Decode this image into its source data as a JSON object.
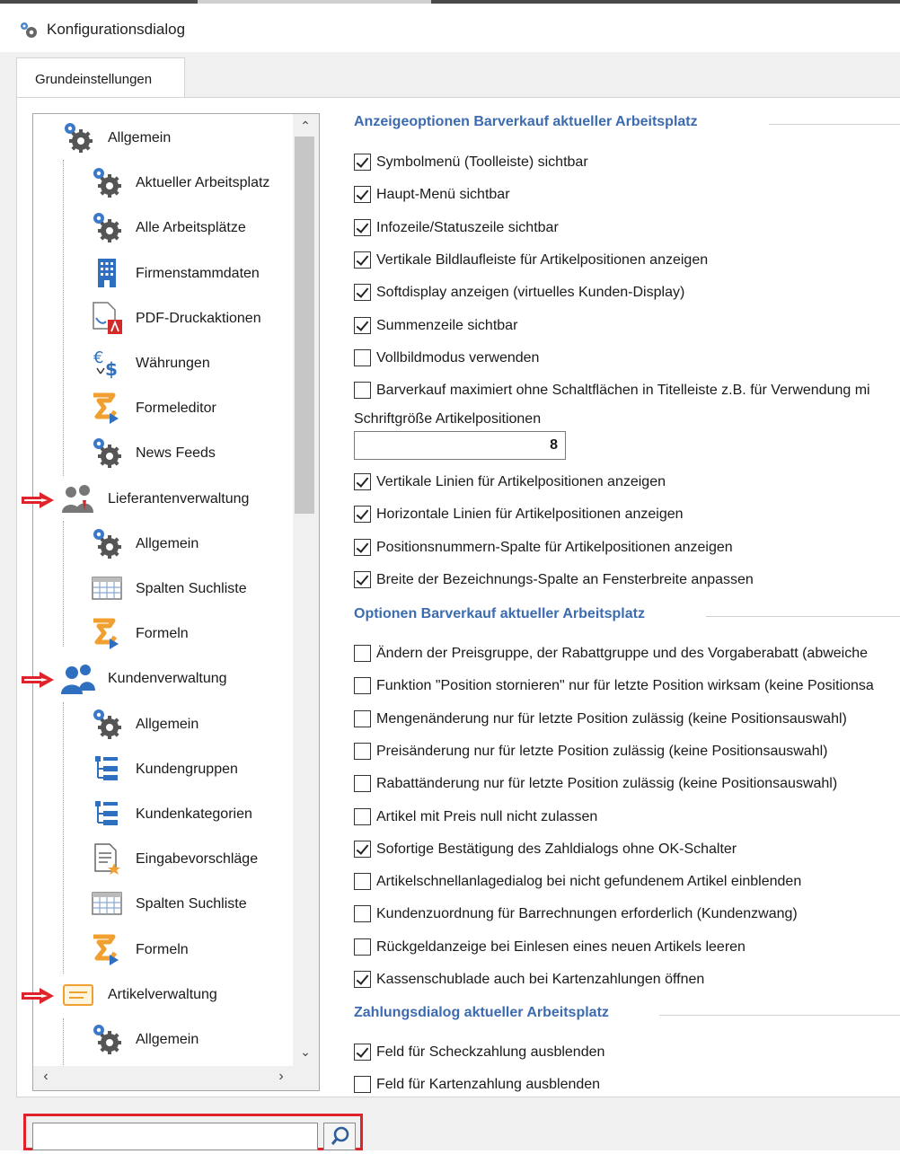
{
  "window": {
    "title": "Konfigurationsdialog"
  },
  "tabs": [
    {
      "label": "Grundeinstellungen"
    }
  ],
  "tree": {
    "items": [
      {
        "label": "Allgemein",
        "icon": "gears-icon"
      },
      {
        "label": "Aktueller Arbeitsplatz",
        "icon": "gears-icon"
      },
      {
        "label": "Alle Arbeitsplätze",
        "icon": "gears-icon"
      },
      {
        "label": "Firmenstammdaten",
        "icon": "building-icon"
      },
      {
        "label": "PDF-Druckaktionen",
        "icon": "pdf-document-icon"
      },
      {
        "label": "Währungen",
        "icon": "currency-icon"
      },
      {
        "label": "Formeleditor",
        "icon": "formula-icon"
      },
      {
        "label": "News Feeds",
        "icon": "gears-icon"
      },
      {
        "label": "Lieferantenverwaltung",
        "icon": "suppliers-icon"
      },
      {
        "label": "Allgemein",
        "icon": "gears-icon"
      },
      {
        "label": "Spalten Suchliste",
        "icon": "table-columns-icon"
      },
      {
        "label": "Formeln",
        "icon": "formula-icon"
      },
      {
        "label": "Kundenverwaltung",
        "icon": "customers-icon"
      },
      {
        "label": "Allgemein",
        "icon": "gears-icon"
      },
      {
        "label": "Kundengruppen",
        "icon": "hierarchy-list-icon"
      },
      {
        "label": "Kundenkategorien",
        "icon": "hierarchy-list-icon"
      },
      {
        "label": "Eingabevorschläge",
        "icon": "document-star-icon"
      },
      {
        "label": "Spalten Suchliste",
        "icon": "table-columns-icon"
      },
      {
        "label": "Formeln",
        "icon": "formula-icon"
      },
      {
        "label": "Artikelverwaltung",
        "icon": "article-card-icon"
      },
      {
        "label": "Allgemein",
        "icon": "gears-icon"
      }
    ]
  },
  "sections": {
    "display": {
      "title": "Anzeigeoptionen Barverkauf aktueller Arbeitsplatz",
      "options": [
        {
          "label": "Symbolmenü (Toolleiste) sichtbar",
          "checked": true
        },
        {
          "label": "Haupt-Menü sichtbar",
          "checked": true
        },
        {
          "label": "Infozeile/Statuszeile sichtbar",
          "checked": true
        },
        {
          "label": "Vertikale Bildlaufleiste für Artikelpositionen anzeigen",
          "checked": true
        },
        {
          "label": "Softdisplay anzeigen (virtuelles Kunden-Display)",
          "checked": true
        },
        {
          "label": "Summenzeile sichtbar",
          "checked": true
        },
        {
          "label": "Vollbildmodus verwenden",
          "checked": false
        },
        {
          "label": "Barverkauf maximiert ohne Schaltflächen in Titelleiste z.B. für Verwendung mi",
          "checked": false
        }
      ],
      "font_size_label": "Schriftgröße Artikelpositionen",
      "font_size_value": "8",
      "options2": [
        {
          "label": "Vertikale Linien für Artikelpositionen anzeigen",
          "checked": true
        },
        {
          "label": "Horizontale Linien für Artikelpositionen anzeigen",
          "checked": true
        },
        {
          "label": "Positionsnummern-Spalte für Artikelpositionen anzeigen",
          "checked": true
        },
        {
          "label": "Breite der Bezeichnungs-Spalte an Fensterbreite anpassen",
          "checked": true
        }
      ]
    },
    "options": {
      "title": "Optionen Barverkauf aktueller Arbeitsplatz",
      "options": [
        {
          "label": "Ändern der Preisgruppe, der Rabattgruppe und des Vorgaberabatt (abweiche",
          "checked": false
        },
        {
          "label": "Funktion \"Position stornieren\" nur für letzte Position wirksam (keine Positionsa",
          "checked": false
        },
        {
          "label": "Mengenänderung nur für letzte Position zulässig (keine Positionsauswahl)",
          "checked": false
        },
        {
          "label": "Preisänderung nur für letzte Position zulässig (keine Positionsauswahl)",
          "checked": false
        },
        {
          "label": "Rabattänderung nur für letzte Position zulässig (keine Positionsauswahl)",
          "checked": false
        },
        {
          "label": "Artikel mit Preis null nicht zulassen",
          "checked": false
        },
        {
          "label": "Sofortige Bestätigung des Zahldialogs ohne OK-Schalter",
          "checked": true
        },
        {
          "label": "Artikelschnellanlagedialog bei nicht gefundenem Artikel einblenden",
          "checked": false
        },
        {
          "label": "Kundenzuordnung für Barrechnungen erforderlich (Kundenzwang)",
          "checked": false
        },
        {
          "label": "Rückgeldanzeige bei Einlesen eines neuen Artikels leeren",
          "checked": false
        },
        {
          "label": "Kassenschublade auch bei Kartenzahlungen öffnen",
          "checked": true
        }
      ]
    },
    "payment": {
      "title": "Zahlungsdialog aktueller Arbeitsplatz",
      "options": [
        {
          "label": "Feld für Scheckzahlung ausblenden",
          "checked": true
        },
        {
          "label": "Feld für Kartenzahlung ausblenden",
          "checked": false
        }
      ]
    }
  },
  "search": {
    "value": "",
    "icon": "search-icon"
  },
  "colors": {
    "accent": "#3c6bb0",
    "highlight": "#e0232a"
  }
}
